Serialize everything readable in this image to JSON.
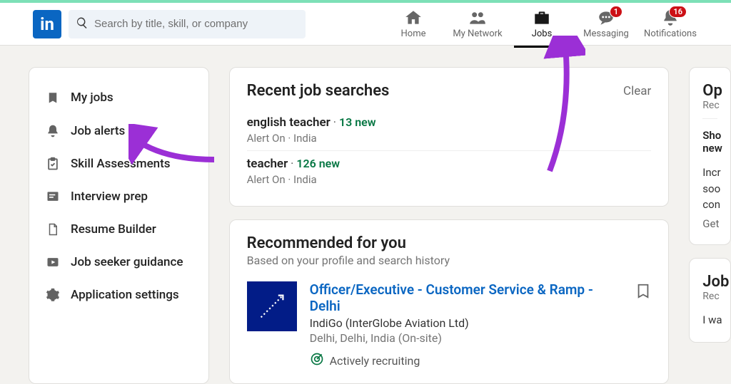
{
  "header": {
    "search_placeholder": "Search by title, skill, or company",
    "nav": {
      "home": "Home",
      "network": "My Network",
      "jobs": "Jobs",
      "messaging": "Messaging",
      "notifications": "Notifications",
      "badge_messaging": "1",
      "badge_notifications": "16"
    }
  },
  "sidebar": {
    "myjobs": "My jobs",
    "alerts": "Job alerts",
    "skill": "Skill Assessments",
    "interview": "Interview prep",
    "resume": "Resume Builder",
    "guidance": "Job seeker guidance",
    "appsettings": "Application settings"
  },
  "recent": {
    "title": "Recent job searches",
    "clear": "Clear",
    "items": [
      {
        "query": "english teacher",
        "new": "13 new",
        "sub": "Alert On · India"
      },
      {
        "query": "teacher",
        "new": "126 new",
        "sub": "Alert On · India"
      }
    ]
  },
  "recommended": {
    "title": "Recommended for you",
    "subtitle": "Based on your profile and search history",
    "job": {
      "title": "Officer/Executive - Customer Service & Ramp - Delhi",
      "company": "IndiGo (InterGlobe Aviation Ltd)",
      "location": "Delhi, Delhi, India (On-site)",
      "recruiting": "Actively recruiting"
    }
  },
  "right": {
    "open_title": "Op",
    "open_sub": "Rec",
    "show": "Sho",
    "show2": "new",
    "body1": "Incr",
    "body2": "soo",
    "body3": "con",
    "get": "Get",
    "job_title": "Job",
    "job_sub": "Rec",
    "iwa": "I wa"
  }
}
